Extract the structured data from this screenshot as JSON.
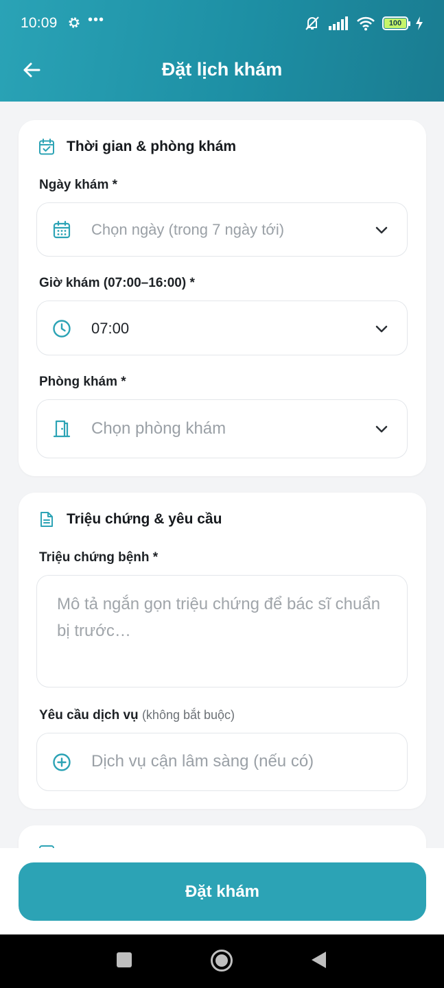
{
  "status_bar": {
    "time": "10:09",
    "dots": "•••",
    "battery": "100",
    "left_icons": [
      "gear-icon"
    ],
    "right_icons": [
      "mute-icon",
      "signal-icon",
      "wifi-icon",
      "battery-icon",
      "charging-icon"
    ]
  },
  "app_bar": {
    "title": "Đặt lịch khám",
    "back_icon": "arrow-left-icon"
  },
  "section_time": {
    "title": "Thời gian & phòng khám",
    "icon": "calendar-check-icon",
    "date_label": "Ngày khám *",
    "date_placeholder": "Chọn ngày (trong 7 ngày tới)",
    "time_label": "Giờ khám (07:00–16:00) *",
    "time_value": "07:00",
    "room_label": "Phòng khám *",
    "room_placeholder": "Chọn phòng khám"
  },
  "section_symptoms": {
    "title": "Triệu chứng & yêu cầu",
    "icon": "document-icon",
    "symptom_label": "Triệu chứng bệnh *",
    "symptom_placeholder": "Mô tả ngắn gọn triệu chứng để bác sĩ chuẩn bị trước…",
    "service_label": "Yêu cầu dịch vụ",
    "service_optional": "(không bắt buộc)",
    "service_placeholder": "Dịch vụ cận lâm sàng (nếu có)"
  },
  "submit_button": "Đặt khám",
  "colors": {
    "accent": "#2ca3b5",
    "header_start": "#2aa3b6",
    "header_end": "#1a7c91",
    "background": "#f3f4f6"
  }
}
